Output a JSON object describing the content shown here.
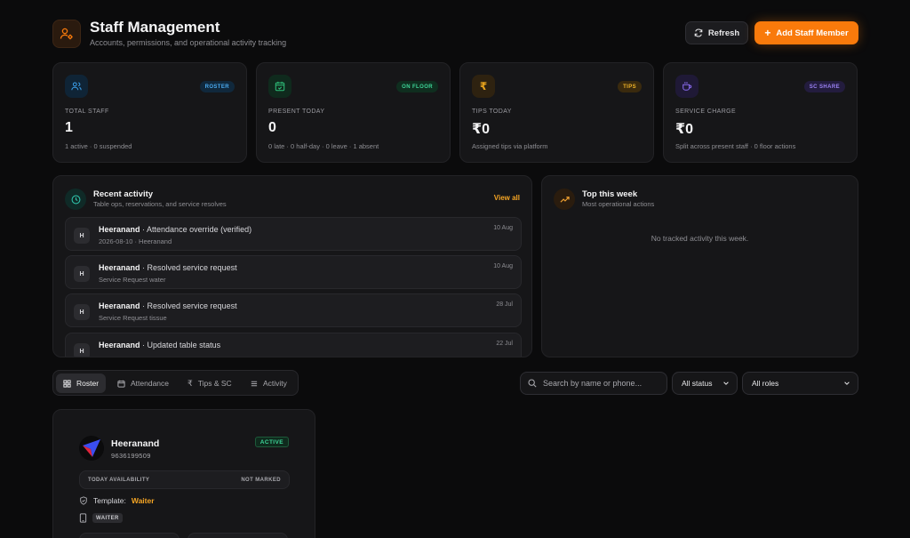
{
  "header": {
    "title": "Staff Management",
    "subtitle": "Accounts, permissions, and operational activity tracking",
    "refresh_label": "Refresh",
    "add_label": "Add Staff Member"
  },
  "stats": [
    {
      "badge": "ROSTER",
      "label": "TOTAL STAFF",
      "value": "1",
      "sub": "1 active · 0 suspended",
      "icon": "users-icon",
      "color": "#3b9ee8"
    },
    {
      "badge": "ON FLOOR",
      "label": "PRESENT TODAY",
      "value": "0",
      "sub": "0 late · 0 half-day · 0 leave · 1 absent",
      "icon": "calendar-check-icon",
      "color": "#2fc07a"
    },
    {
      "badge": "TIPS",
      "label": "TIPS TODAY",
      "value": "₹0",
      "sub": "Assigned tips via platform",
      "icon": "rupee-icon",
      "color": "#e6a21c"
    },
    {
      "badge": "SC SHARE",
      "label": "SERVICE CHARGE",
      "value": "₹0",
      "sub": "Split across present staff · 0 floor actions",
      "icon": "coffee-icon",
      "color": "#8b6cf0"
    }
  ],
  "recent": {
    "title": "Recent activity",
    "subtitle": "Table ops, reservations, and service resolves",
    "view_all": "View all",
    "items": [
      {
        "initial": "H",
        "actor": "Heeranand",
        "action": " · Attendance override (verified)",
        "detail": "2026-08-10 · Heeranand",
        "date": "10 Aug"
      },
      {
        "initial": "H",
        "actor": "Heeranand",
        "action": " · Resolved service request",
        "detail": "Service Request water",
        "date": "10 Aug"
      },
      {
        "initial": "H",
        "actor": "Heeranand",
        "action": " · Resolved service request",
        "detail": "Service Request tissue",
        "date": "28 Jul"
      },
      {
        "initial": "H",
        "actor": "Heeranand",
        "action": " · Updated table status",
        "detail": "",
        "date": "22 Jul"
      }
    ]
  },
  "top_week": {
    "title": "Top this week",
    "subtitle": "Most operational actions",
    "empty": "No tracked activity this week."
  },
  "tabs": [
    {
      "label": "Roster",
      "icon": "grid-icon",
      "active": true
    },
    {
      "label": "Attendance",
      "icon": "calendar-icon",
      "active": false
    },
    {
      "label": "Tips & SC",
      "icon": "rupee-icon",
      "active": false
    },
    {
      "label": "Activity",
      "icon": "list-icon",
      "active": false
    }
  ],
  "filters": {
    "search_placeholder": "Search by name or phone...",
    "status_value": "All status",
    "roles_value": "All roles"
  },
  "staff_card": {
    "name": "Heeranand",
    "phone": "9636199509",
    "status": "ACTIVE",
    "availability_label": "TODAY AVAILABILITY",
    "availability_value": "NOT MARKED",
    "template_label": "Template:",
    "template_value": "Waiter",
    "role": "WAITER"
  }
}
